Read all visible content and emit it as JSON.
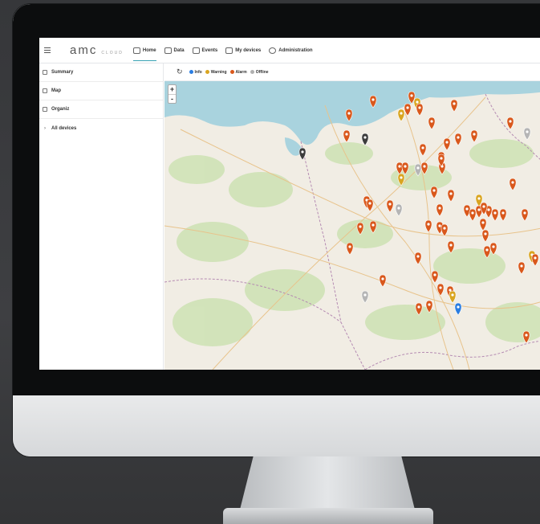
{
  "app": {
    "logo_main": "amc",
    "logo_sub": "CLOUD"
  },
  "nav": {
    "items": [
      {
        "label": "Home",
        "icon": "home-icon",
        "active": true
      },
      {
        "label": "Data",
        "icon": "data-chart-icon",
        "active": false
      },
      {
        "label": "Events",
        "icon": "calendar-icon",
        "active": false
      },
      {
        "label": "My devices",
        "icon": "devices-icon",
        "active": false
      },
      {
        "label": "Administration",
        "icon": "gear-icon",
        "active": false
      }
    ]
  },
  "sidebar": {
    "items": [
      {
        "label": "Summary",
        "icon": "summary-icon"
      },
      {
        "label": "Map",
        "icon": "map-icon"
      },
      {
        "label": "Organiz",
        "icon": "organization-icon"
      },
      {
        "label": "All devices",
        "icon": "chevron-right-icon"
      }
    ]
  },
  "map": {
    "refresh_icon": "refresh-icon",
    "zoom_in": "+",
    "zoom_out": "-",
    "legend": [
      {
        "label": "Info",
        "color": "#2a7de1"
      },
      {
        "label": "Warning",
        "color": "#d9a520"
      },
      {
        "label": "Alarm",
        "color": "#d9581c"
      },
      {
        "label": "Offline",
        "color": "#b0b0b0"
      }
    ],
    "colors": {
      "sea": "#a9d3de",
      "land": "#f1ede4",
      "forest": "#cfe2b6",
      "alarm": "#d9581c",
      "warning": "#d9a520",
      "info": "#2a7de1",
      "offline": "#b5b5b5",
      "dark": "#3c3c3c"
    }
  },
  "monitor": {
    "bezel_color": "#0c0d0e",
    "chin_color": "#e1e3e5",
    "background": "#3a3b3d"
  }
}
